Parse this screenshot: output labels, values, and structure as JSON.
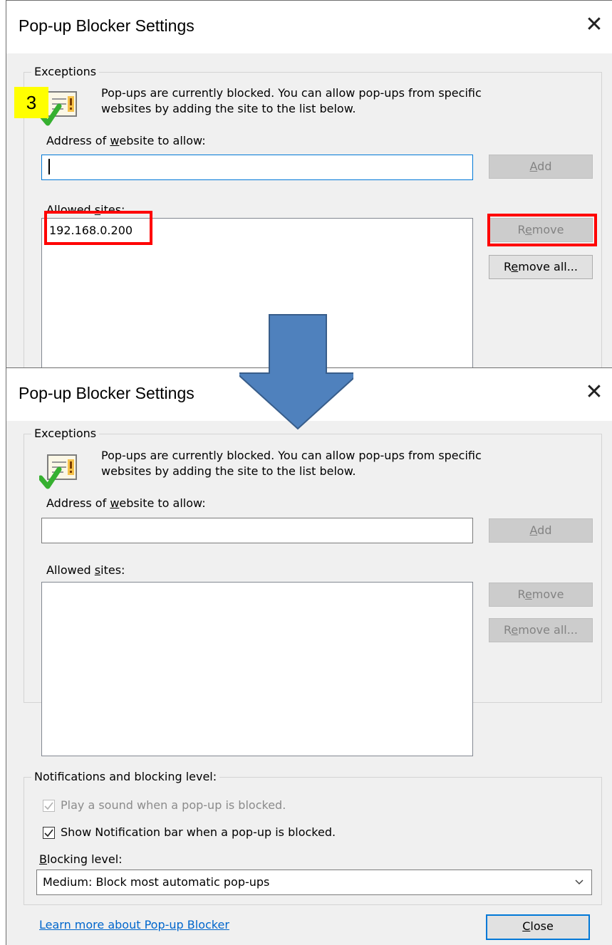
{
  "colors": {
    "accent_blue": "#0078d7",
    "highlight_red": "#ff0000",
    "arrow_fill": "#4f81bd",
    "arrow_stroke": "#385d8a",
    "badge_yellow": "#ffff00",
    "link_blue": "#0066cc"
  },
  "annotation": {
    "step": "3"
  },
  "before": {
    "title": "Pop-up Blocker Settings",
    "close_icon": "close-icon",
    "exceptions": {
      "legend": "Exceptions",
      "description_line1": "Pop-ups are currently blocked.  You can allow pop-ups from specific",
      "description_line2": "websites by adding the site to the list below.",
      "address_label_pre": "Address of ",
      "address_label_key": "w",
      "address_label_post": "ebsite to allow:",
      "address_value": "",
      "add_label_key": "A",
      "add_label_post": "dd",
      "allowed_label_pre": "Allowed ",
      "allowed_label_key": "s",
      "allowed_label_post": "ites:",
      "allowed_sites": [
        "192.168.0.200"
      ],
      "remove_label_pre": "R",
      "remove_label_key": "e",
      "remove_label_post": "move",
      "remove_all_label_pre": "R",
      "remove_all_label_key": "e",
      "remove_all_label_post": "move all..."
    }
  },
  "after": {
    "title": "Pop-up Blocker Settings",
    "exceptions": {
      "legend": "Exceptions",
      "description_line1": "Pop-ups are currently blocked.  You can allow pop-ups from specific",
      "description_line2": "websites by adding the site to the list below.",
      "address_label_pre": "Address of ",
      "address_label_key": "w",
      "address_label_post": "ebsite to allow:",
      "address_value": "",
      "add_label_key": "A",
      "add_label_post": "dd",
      "allowed_label_pre": "Allowed ",
      "allowed_label_key": "s",
      "allowed_label_post": "ites:",
      "allowed_sites": [],
      "remove_label_pre": "R",
      "remove_label_key": "e",
      "remove_label_post": "move",
      "remove_all_label_pre": "R",
      "remove_all_label_key": "e",
      "remove_all_label_post": "move all..."
    },
    "notifications": {
      "legend": "Notifications and blocking level:",
      "play_sound_label": "Play a sound when a pop-up is blocked.",
      "play_sound_checked": true,
      "show_bar_label": "Show Notification bar when a pop-up is blocked.",
      "show_bar_checked": true,
      "blocking_label_key": "B",
      "blocking_label_post": "locking level:",
      "blocking_value": "Medium: Block most automatic pop-ups"
    },
    "learn_more_link": "Learn more about Pop-up Blocker",
    "close_label_key": "C",
    "close_label_post": "lose"
  }
}
